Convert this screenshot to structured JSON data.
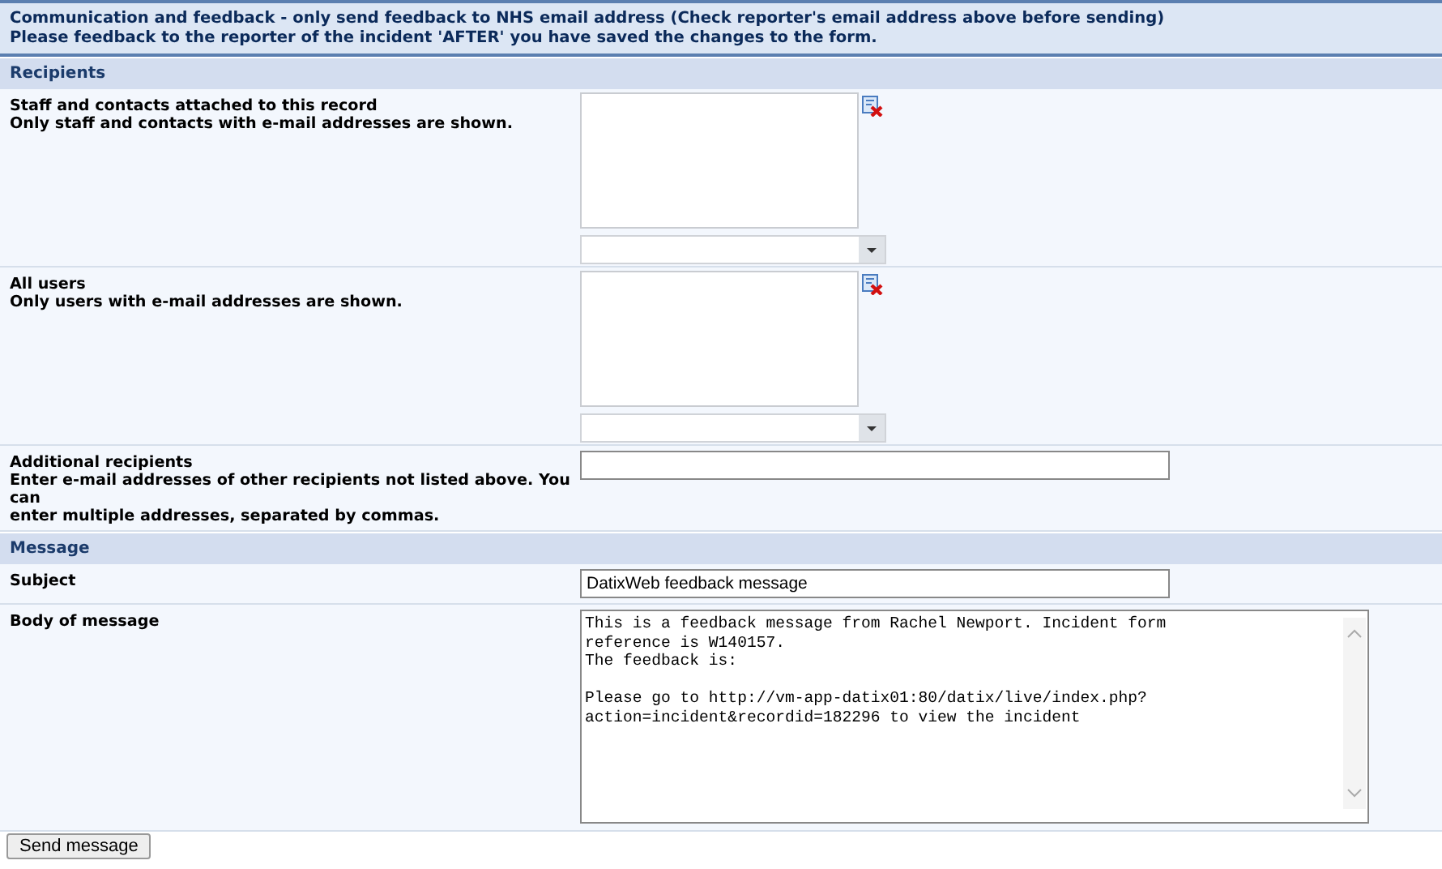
{
  "header": {
    "lines": [
      "Communication and feedback - only send feedback to NHS email address (Check reporter's email address above before sending)",
      "Please feedback to the reporter of the incident 'AFTER' you have saved the changes to the form."
    ]
  },
  "sections": [
    {
      "title": "Recipients",
      "rows": [
        {
          "kind": "listbox",
          "label": "Staff and contacts attached to this record",
          "help": [
            "Only staff and contacts with e-mail addresses are shown."
          ]
        },
        {
          "kind": "listbox",
          "label": "All users",
          "help": [
            "Only users with e-mail addresses are shown."
          ]
        },
        {
          "kind": "text",
          "label": "Additional recipients",
          "help": [
            "Enter e-mail addresses of other recipients not listed above. You",
            "can",
            "enter multiple addresses, separated by commas."
          ]
        }
      ]
    },
    {
      "title": "Message",
      "rows": [
        {
          "kind": "text",
          "label": "Subject",
          "value": "DatixWeb feedback message"
        },
        {
          "kind": "textarea",
          "label": "Body of message",
          "value": [
            [
              "This is a feedback message from Rachel Newport. Incident form",
              "reference is W140157.",
              "The feedback is:"
            ],
            [
              "Please go to http://vm-app-datix01:80/datix/live/index.php?",
              "action=incident&recordid=182296 to view the incident"
            ]
          ]
        }
      ]
    }
  ],
  "button": "Send message"
}
